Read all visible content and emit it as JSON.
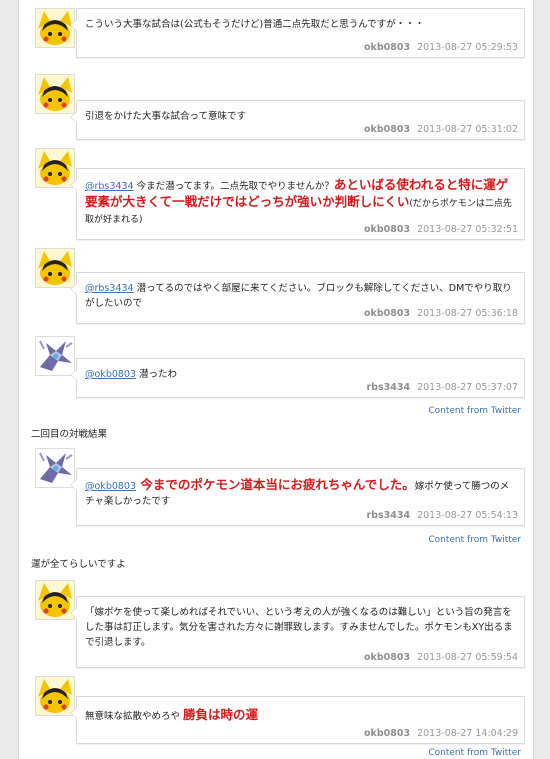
{
  "tweets": [
    {
      "user": "okb0803",
      "time": "2013-08-27 05:29:53",
      "text": "こういう大事な試合は(公式もそうだけど)普通二点先取だと思うんですが・・・"
    },
    {
      "user": "okb0803",
      "time": "2013-08-27 05:31:02",
      "text": "引退をかけた大事な試合って意味です"
    },
    {
      "user": "okb0803",
      "time": "2013-08-27 05:32:51",
      "mention": "@rbs3434",
      "text": " 今まだ潜ってます。二点先取でやりませんか？",
      "emphasis": "あといばる使われると特に運ゲ要素が大きくて一戦だけではどっちが強いか判断しにくい",
      "tail": "(だからポケモンは二点先取が好まれる)"
    },
    {
      "user": "okb0803",
      "time": "2013-08-27 05:36:18",
      "mention": "@rbs3434",
      "text": " 潜ってるのではやく部屋に来てください。ブロックも解除してください、DMでやり取りがしたいので"
    },
    {
      "user": "rbs3434",
      "time": "2013-08-27 05:37:07",
      "mention": "@okb0803",
      "text": " 潜ったわ"
    },
    {
      "user": "rbs3434",
      "time": "2013-08-27 05:54:13",
      "mention": "@okb0803",
      "emphasis": " 今までのポケモン道本当にお疲れちゃんでした。",
      "tail": "嫁ポケ使って勝つのメチャ楽しかったです"
    },
    {
      "user": "okb0803",
      "time": "2013-08-27 05:59:54",
      "text": "「嫁ポケを使って楽しめればそれでいい、という考えの人が強くなるのは難しい」という旨の発言をした事は訂正します。気分を害された方々に謝罪致します。すみませんでした。ポケモンもXY出るまで引退します。"
    },
    {
      "user": "okb0803",
      "time": "2013-08-27 14:04:29",
      "text": "無意味な拡散やめろや ",
      "emphasis": "勝負は時の運"
    }
  ],
  "captions": {
    "second_match": "二回目の対戦結果",
    "luck": "運が全てらしいですよ"
  },
  "content_from": "Content from Twitter",
  "colors": {
    "link": "#3b6fb6",
    "emphasis": "#d51a1a",
    "meta": "#999999"
  },
  "icons": {
    "okb0803": "pikachu-hat-avatar",
    "rbs3434": "dialga-like-pokemon-avatar"
  }
}
